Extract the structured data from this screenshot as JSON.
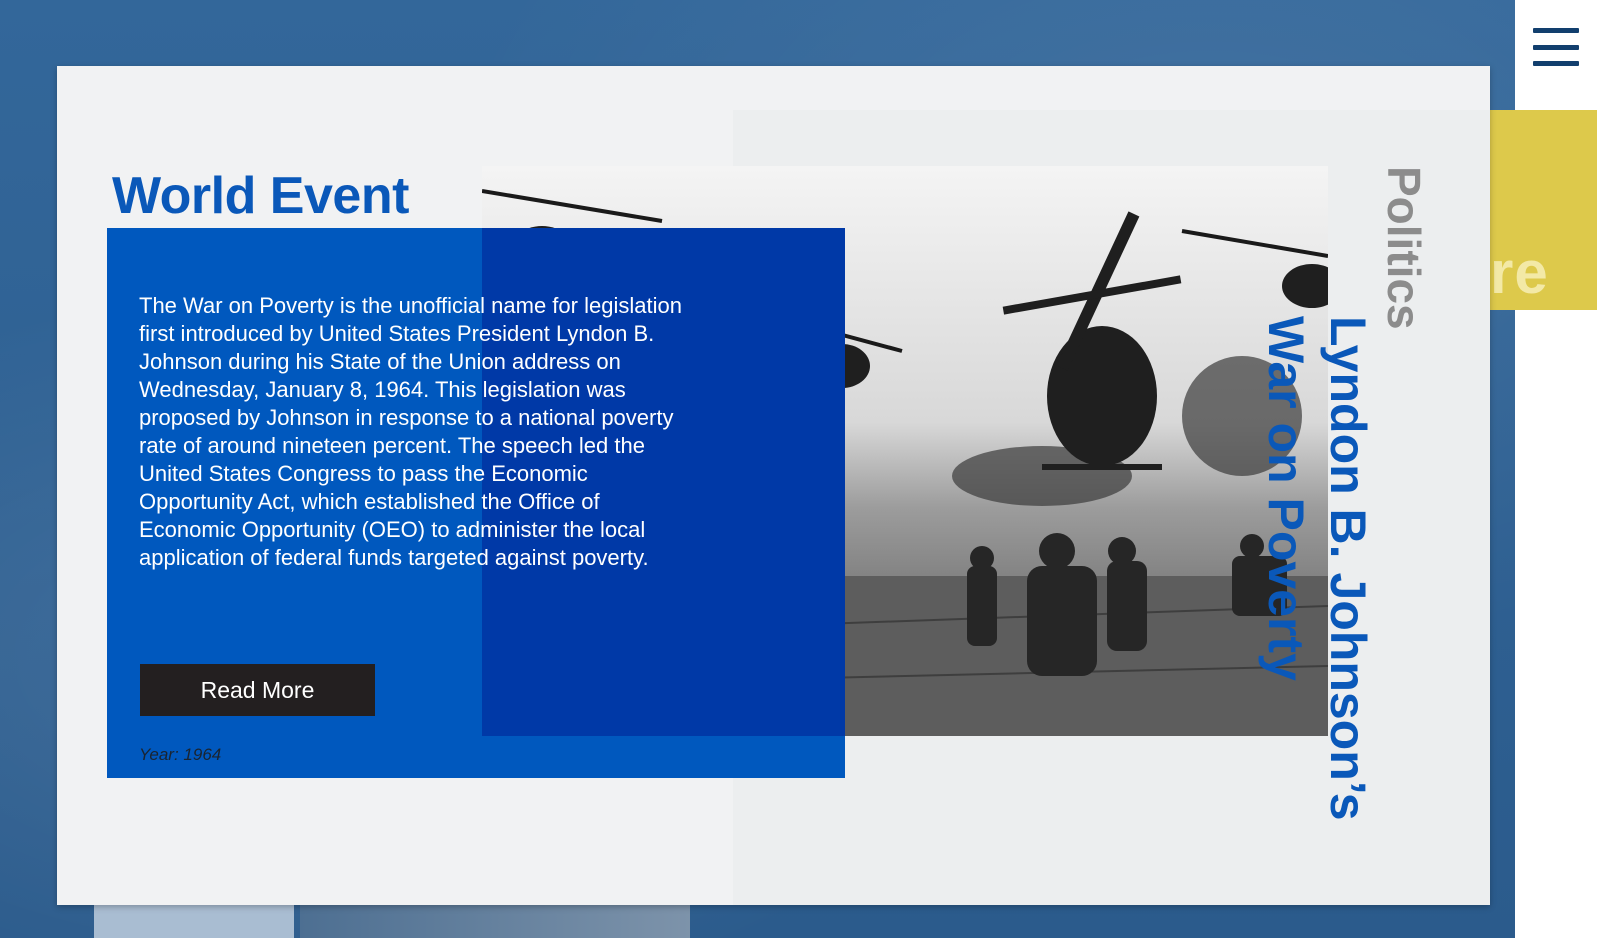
{
  "menu": {
    "icon": "hamburger-menu-icon"
  },
  "side_tab": {
    "text": "re"
  },
  "card": {
    "title": "World Event",
    "description": "The War on Poverty is the unofficial name for legislation first introduced by United States President Lyndon B. Johnson during his State of the Union address on Wednesday, January 8, 1964. This legislation was proposed by Johnson in response to a national poverty rate of around nineteen percent. The speech led the United States Congress to pass the Economic Opportunity Act, which established the Office of Economic Opportunity (OEO) to administer the local application of federal funds targeted against poverty.",
    "button_label": "Read More",
    "year": "Year: 1964",
    "category": "Politics",
    "headline_line1": "Lyndon B. Johnson’s",
    "headline_line2": "War on Poverty"
  },
  "colors": {
    "brand_blue": "#0a58b9",
    "background": "#2f5f8f",
    "accent_yellow": "#ddc94b",
    "button_dark": "#231f20"
  }
}
